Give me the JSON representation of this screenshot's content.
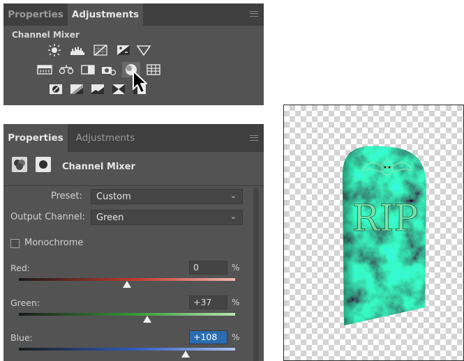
{
  "top_panel": {
    "tabs": [
      "Properties",
      "Adjustments"
    ],
    "active_tab": 1,
    "title": "Channel Mixer",
    "icon_rows": [
      [
        "brightness-contrast-icon",
        "levels-icon",
        "curves-icon",
        "exposure-icon",
        "triangle-icon"
      ],
      [
        "vibrance-icon",
        "color-balance-icon",
        "black-white-icon",
        "photo-filter-icon",
        "channel-mixer-icon",
        "color-lookup-icon"
      ],
      [
        "invert-icon",
        "posterize-icon",
        "threshold-icon",
        "gradient-map-icon",
        "selective-color-icon"
      ]
    ]
  },
  "properties_panel": {
    "tabs": [
      "Properties",
      "Adjustments"
    ],
    "active_tab": 0,
    "title": "Channel Mixer",
    "preset_label": "Preset:",
    "preset_value": "Custom",
    "output_label": "Output Channel:",
    "output_value": "Green",
    "monochrome_label": "Monochrome",
    "monochrome_checked": false,
    "channels": [
      {
        "name": "Red:",
        "value": "0",
        "unit": "%",
        "level_pct": 0
      },
      {
        "name": "Green:",
        "value": "+37",
        "unit": "%",
        "level_pct": 37
      },
      {
        "name": "Blue:",
        "value": "+108",
        "unit": "%",
        "level_pct": 108
      }
    ]
  },
  "image": {
    "text": "RIP",
    "colors": {
      "glow": "#7fe8a6",
      "dark": "#0b1f10",
      "mid": "#2e8a4a"
    }
  }
}
